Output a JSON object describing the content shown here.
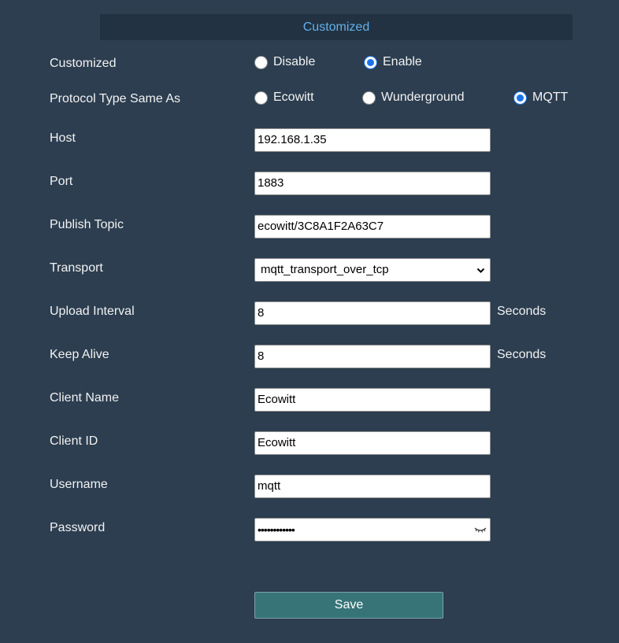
{
  "section_title": "Customized",
  "customized": {
    "label": "Customized",
    "options": [
      "Disable",
      "Enable"
    ],
    "selected": "Enable"
  },
  "protocol": {
    "label": "Protocol Type Same As",
    "options": [
      "Ecowitt",
      "Wunderground",
      "MQTT"
    ],
    "selected": "MQTT"
  },
  "host": {
    "label": "Host",
    "value": "192.168.1.35"
  },
  "port": {
    "label": "Port",
    "value": "1883"
  },
  "publish_topic": {
    "label": "Publish Topic",
    "value": "ecowitt/3C8A1F2A63C7"
  },
  "transport": {
    "label": "Transport",
    "value": "mqtt_transport_over_tcp"
  },
  "upload_interval": {
    "label": "Upload Interval",
    "value": "8",
    "unit": "Seconds"
  },
  "keep_alive": {
    "label": "Keep Alive",
    "value": "8",
    "unit": "Seconds"
  },
  "client_name": {
    "label": "Client Name",
    "value": "Ecowitt"
  },
  "client_id": {
    "label": "Client ID",
    "value": "Ecowitt"
  },
  "username": {
    "label": "Username",
    "value": "mqtt"
  },
  "password": {
    "label": "Password",
    "masked_value": "••••••••••••"
  },
  "save_label": "Save",
  "colors": {
    "background": "#2c3e50",
    "header_bg": "#223242",
    "header_text": "#62b0ec",
    "radio_selected": "#1a73e8",
    "save_button": "#367478"
  }
}
